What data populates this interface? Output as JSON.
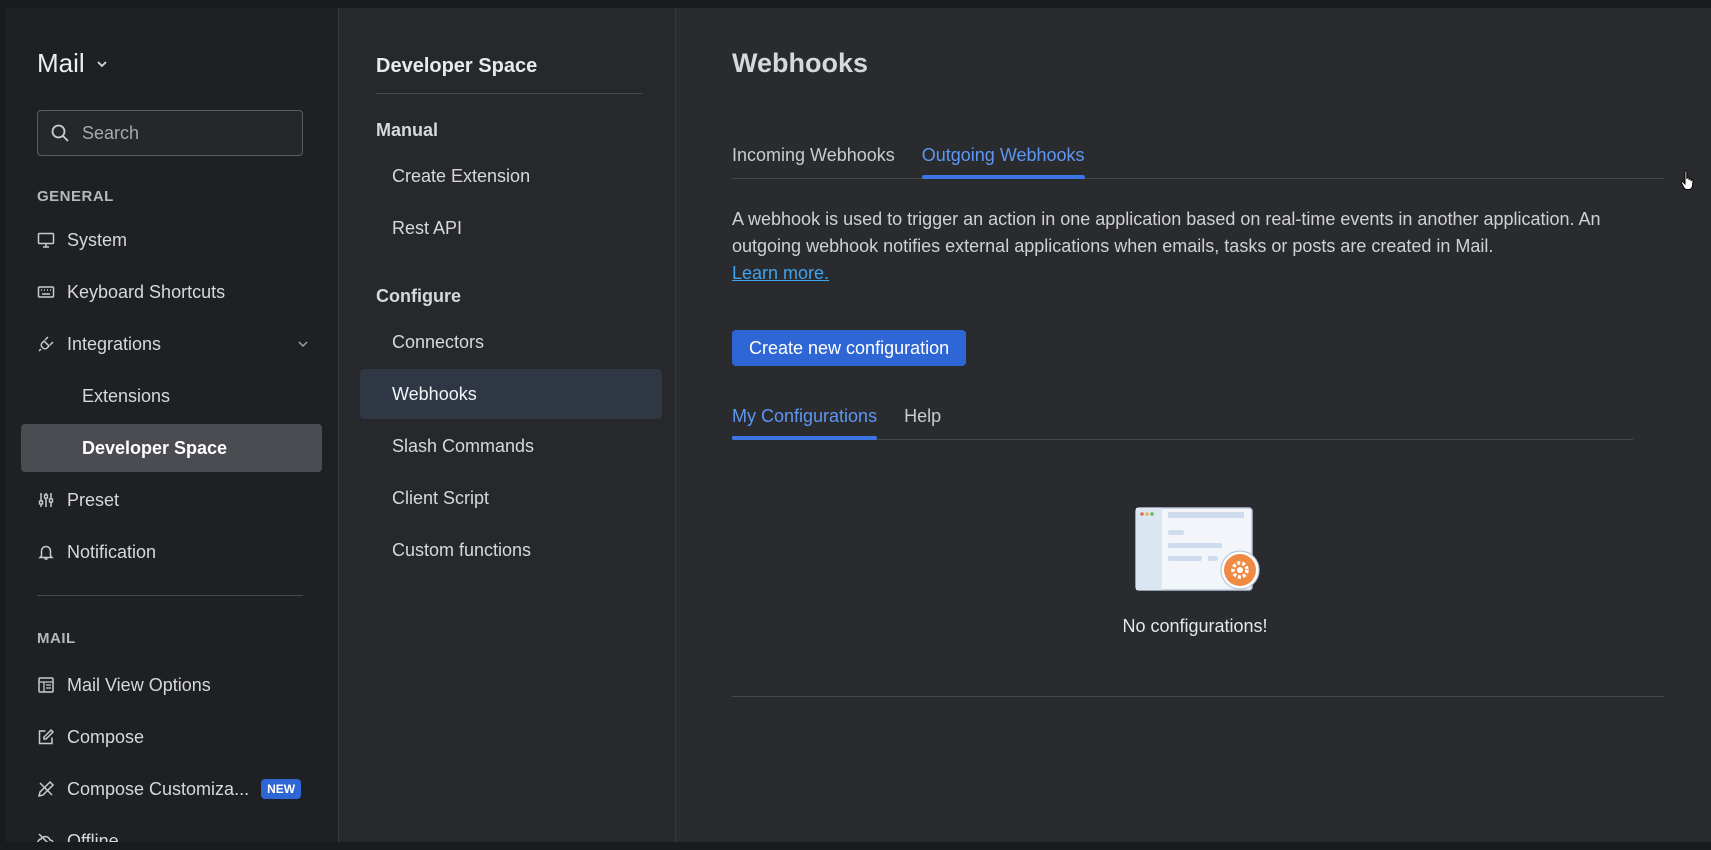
{
  "app": {
    "title": "Mail"
  },
  "search": {
    "placeholder": "Search"
  },
  "sidebar": {
    "general_label": "GENERAL",
    "mail_label": "MAIL",
    "items": [
      {
        "label": "System",
        "icon": "monitor-icon"
      },
      {
        "label": "Keyboard Shortcuts",
        "icon": "keyboard-icon"
      },
      {
        "label": "Integrations",
        "icon": "plug-icon"
      },
      {
        "label": "Extensions"
      },
      {
        "label": "Developer Space"
      },
      {
        "label": "Preset",
        "icon": "sliders-icon"
      },
      {
        "label": "Notification",
        "icon": "bell-icon"
      }
    ],
    "mail_items": [
      {
        "label": "Mail View Options",
        "icon": "layout-icon"
      },
      {
        "label": "Compose",
        "icon": "edit-icon"
      },
      {
        "label": "Compose Customiza...",
        "icon": "tools-icon",
        "badge": "NEW"
      },
      {
        "label": "Offline",
        "icon": "cloud-off-icon"
      }
    ]
  },
  "mid": {
    "title": "Developer Space",
    "group_manual": "Manual",
    "group_configure": "Configure",
    "manual_items": [
      "Create Extension",
      "Rest API"
    ],
    "configure_items": [
      "Connectors",
      "Webhooks",
      "Slash Commands",
      "Client Script",
      "Custom functions"
    ]
  },
  "main": {
    "title": "Webhooks",
    "tabs": [
      "Incoming Webhooks",
      "Outgoing Webhooks"
    ],
    "description": "A webhook is used to trigger an action in one application based on real-time events in another application. An outgoing webhook notifies external applications when emails, tasks or posts are created in Mail.",
    "learn_more": "Learn more.",
    "create_button": "Create new configuration",
    "subtabs": [
      "My Configurations",
      "Help"
    ],
    "empty_text": "No configurations!"
  },
  "colors": {
    "accent": "#2f66d6",
    "link": "#3ea4f0",
    "active_tab": "#5d97f2"
  }
}
